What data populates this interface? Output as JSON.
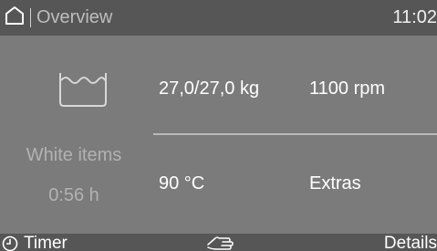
{
  "header": {
    "home_icon": "home-icon",
    "breadcrumb": "Overview",
    "time": "11:02"
  },
  "program": {
    "icon": "washing-tub-icon",
    "name": "White items",
    "duration": "0:56 h"
  },
  "settings": {
    "load": "27,0/27,0 kg",
    "spin_speed": "1100 rpm",
    "temperature": "90 °C",
    "extras": "Extras"
  },
  "footer": {
    "timer_icon": "clock-icon",
    "timer_label": "Timer",
    "hand_icon": "hand-wash-icon",
    "details_label": "Details"
  },
  "colors": {
    "background": "#7b7b7b",
    "bars": "#565656",
    "text_primary": "#ffffff",
    "text_muted": "#b2b2b2"
  }
}
